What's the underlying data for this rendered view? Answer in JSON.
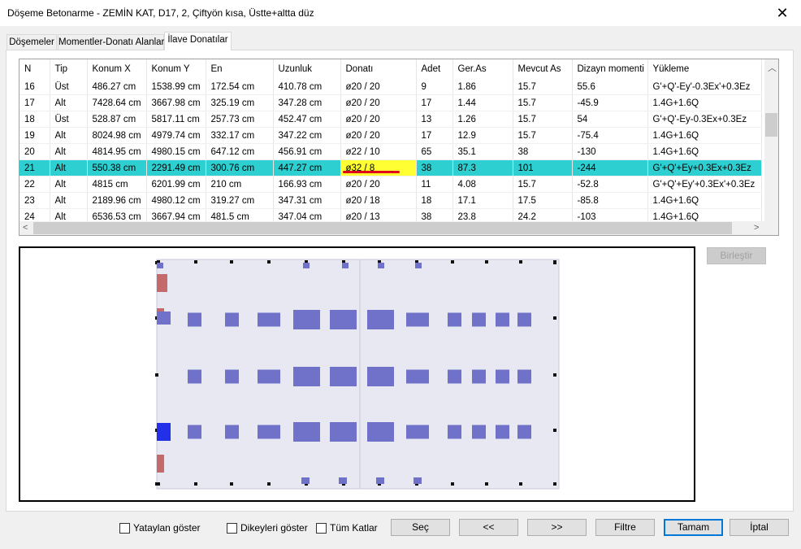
{
  "window": {
    "title": "Döşeme Betonarme - ZEMİN KAT, D17, 2, Çiftyön kısa, Üstte+altta düz",
    "close_glyph": "✕"
  },
  "tabs": [
    "Döşemeler",
    "Momentler-Donatı Alanları",
    "İlave Donatılar"
  ],
  "table": {
    "columns": [
      "N",
      "Tip",
      "Konum X",
      "Konum Y",
      "En",
      "Uzunluk",
      "Donatı",
      "Adet",
      "Ger.As",
      "Mevcut As",
      "Dizayn momenti",
      "Yükleme"
    ],
    "rows": [
      [
        "16",
        "Üst",
        "486.27 cm",
        "1538.99 cm",
        "172.54 cm",
        "410.78 cm",
        "ø20 / 20",
        "9",
        "1.86",
        "15.7",
        "55.6",
        "G'+Q'-Ey'-0.3Ex'+0.3Ez"
      ],
      [
        "17",
        "Alt",
        "7428.64 cm",
        "3667.98 cm",
        "325.19 cm",
        "347.28 cm",
        "ø20 / 20",
        "17",
        "1.44",
        "15.7",
        "-45.9",
        "1.4G+1.6Q"
      ],
      [
        "18",
        "Üst",
        "528.87 cm",
        "5817.11 cm",
        "257.73 cm",
        "452.47 cm",
        "ø20 / 20",
        "13",
        "1.26",
        "15.7",
        "54",
        "G'+Q'-Ey-0.3Ex+0.3Ez"
      ],
      [
        "19",
        "Alt",
        "8024.98 cm",
        "4979.74 cm",
        "332.17 cm",
        "347.22 cm",
        "ø20 / 20",
        "17",
        "12.9",
        "15.7",
        "-75.4",
        "1.4G+1.6Q"
      ],
      [
        "20",
        "Alt",
        "4814.95 cm",
        "4980.15 cm",
        "647.12 cm",
        "456.91 cm",
        "ø22 / 10",
        "65",
        "35.1",
        "38",
        "-130",
        "1.4G+1.6Q"
      ],
      [
        "21",
        "Alt",
        "550.38 cm",
        "2291.49 cm",
        "300.76 cm",
        "447.27 cm",
        "ø32 / 8",
        "38",
        "87.3",
        "101",
        "-244",
        "G'+Q'+Ey+0.3Ex+0.3Ez"
      ],
      [
        "22",
        "Alt",
        "4815 cm",
        "6201.99 cm",
        "210 cm",
        "166.93 cm",
        "ø20 / 20",
        "11",
        "4.08",
        "15.7",
        "-52.8",
        "G'+Q'+Ey'+0.3Ex'+0.3Ez"
      ],
      [
        "23",
        "Alt",
        "2189.96 cm",
        "4980.12 cm",
        "319.27 cm",
        "347.31 cm",
        "ø20 / 18",
        "18",
        "17.1",
        "17.5",
        "-85.8",
        "1.4G+1.6Q"
      ],
      [
        "24",
        "Alt",
        "6536.53 cm",
        "3667.94 cm",
        "481.5 cm",
        "347.04 cm",
        "ø20 / 13",
        "38",
        "23.8",
        "24.2",
        "-103",
        "1.4G+1.6Q"
      ]
    ],
    "selected_row": 5
  },
  "buttons": {
    "birlestir": "Birleştir",
    "sec": "Seç",
    "prev": "<<",
    "next": ">>",
    "filtre": "Filtre",
    "tamam": "Tamam",
    "iptal": "İptal"
  },
  "checkboxes": [
    "Yataylan göster",
    "Dikeyleri göster",
    "Tüm Katlar"
  ],
  "colors": {
    "selection": "#2ecfd1",
    "highlight": "#ffff33",
    "underline": "#e0001b",
    "rebar": "#6f72c8",
    "rebar_selected": "#2230e8",
    "upper_rebar": "#c46a6a",
    "slab": "#e8e8f2"
  }
}
